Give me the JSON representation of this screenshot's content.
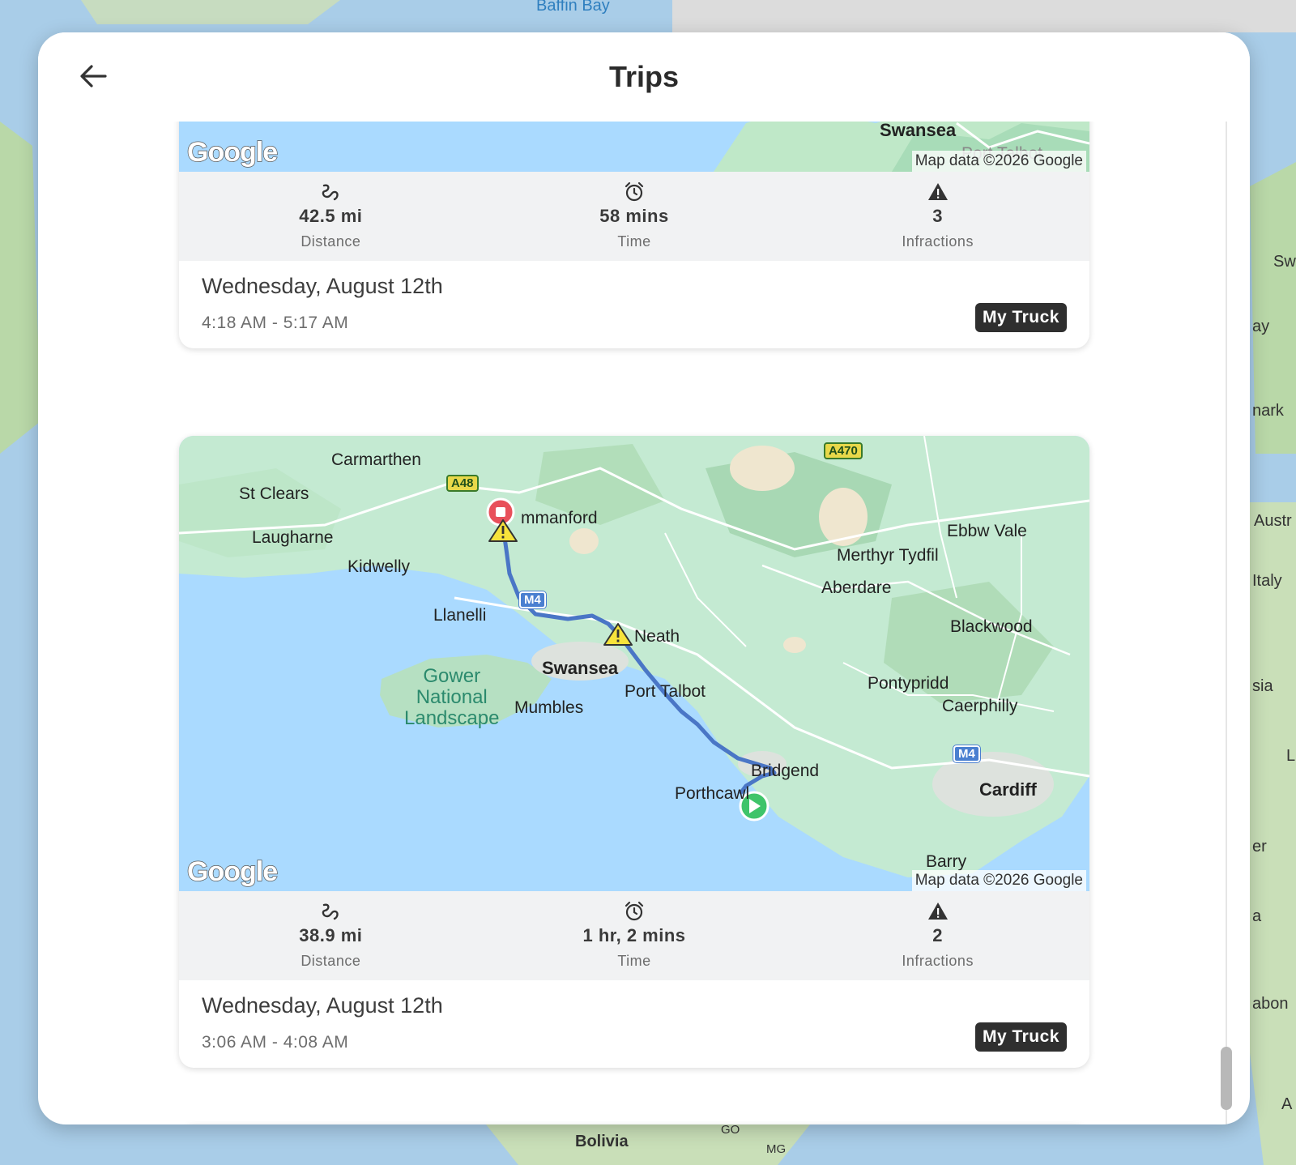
{
  "background": {
    "labels": [
      "Baffin Bay",
      "Bolivia",
      "GO",
      "MG",
      "Sw",
      "ay",
      "nark",
      "Austr",
      "Italy",
      "sia",
      "er",
      "a",
      "abon",
      "A",
      "L"
    ]
  },
  "header": {
    "title": "Trips",
    "back_icon": "arrow-left-icon"
  },
  "trips": [
    {
      "map": {
        "labels": [
          "Swansea",
          "Port Talbot"
        ],
        "logo": "Google",
        "attribution": "Map data ©2026 Google"
      },
      "stats": {
        "distance_value": "42.5 mi",
        "distance_label": "Distance",
        "time_value": "58 mins",
        "time_label": "Time",
        "infractions_value": "3",
        "infractions_label": "Infractions"
      },
      "date": "Wednesday, August 12th",
      "time_range": "4:18 AM - 5:17 AM",
      "vehicle": "My Truck"
    },
    {
      "map": {
        "labels": {
          "carmarthen": "Carmarthen",
          "st_clears": "St Clears",
          "laugharne": "Laugharne",
          "kidwelly": "Kidwelly",
          "ammanford": "mmanford",
          "llanelli": "Llanelli",
          "neath": "Neath",
          "swansea": "Swansea",
          "port_talbot": "Port Talbot",
          "mumbles": "Mumbles",
          "gower": "Gower\nNational\nLandscape",
          "ebbw_vale": "Ebbw Vale",
          "merthyr": "Merthyr Tydfil",
          "aberdare": "Aberdare",
          "blackwood": "Blackwood",
          "pontypridd": "Pontypridd",
          "caerphilly": "Caerphilly",
          "bridgend": "Bridgend",
          "porthcawl": "Porthcawl",
          "cardiff": "Cardiff",
          "barry": "Barry"
        },
        "shields": {
          "a48": "A48",
          "a470": "A470",
          "m4_west": "M4",
          "m4_east": "M4"
        },
        "logo": "Google",
        "attribution": "Map data ©2026 Google"
      },
      "stats": {
        "distance_value": "38.9 mi",
        "distance_label": "Distance",
        "time_value": "1 hr, 2 mins",
        "time_label": "Time",
        "infractions_value": "2",
        "infractions_label": "Infractions"
      },
      "date": "Wednesday, August 12th",
      "time_range": "3:06 AM - 4:08 AM",
      "vehicle": "My Truck"
    }
  ]
}
